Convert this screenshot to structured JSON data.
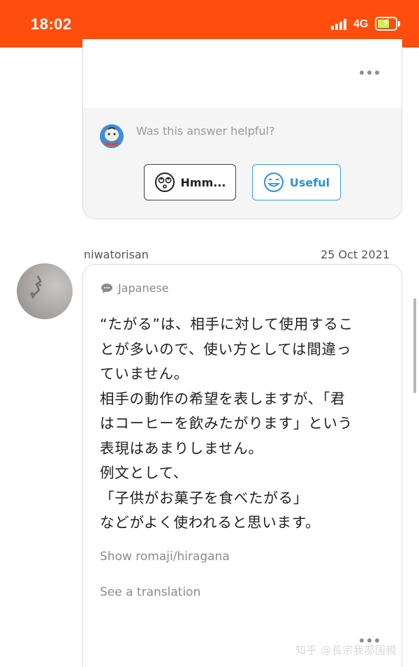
{
  "status_bar": {
    "time": "18:02",
    "network": "4G"
  },
  "feedback": {
    "question": "Was this answer helpful?",
    "hmm_label": "Hmm...",
    "useful_label": "Useful"
  },
  "answer": {
    "username": "niwatorisan",
    "date": "25 Oct 2021",
    "language": "Japanese",
    "body": "“たがる”は、相手に対して使用するこ\nとが多いので、使い方としては間違っ\nていません。\n相手の動作の希望を表しますが、「君\nはコーヒーを飲みたがります」という\n表現はあまりしません。\n例文として、\n「子供がお菓子を食べたがる」\nなどがよく使われると思います。",
    "show_romaji": "Show romaji/hiragana",
    "see_translation": "See a translation"
  },
  "watermark": "知乎 @長宗我部国親",
  "colors": {
    "brand": "#ff4d0d",
    "useful": "#3a9ee6",
    "text": "#1f1f1f",
    "muted": "#8c8c8c"
  },
  "icons": [
    "signal-icon",
    "battery-charging-icon",
    "more-dots-icon",
    "bot-avatar-icon",
    "rolling-eyes-face-icon",
    "smiling-face-icon",
    "speech-bubble-icon"
  ]
}
